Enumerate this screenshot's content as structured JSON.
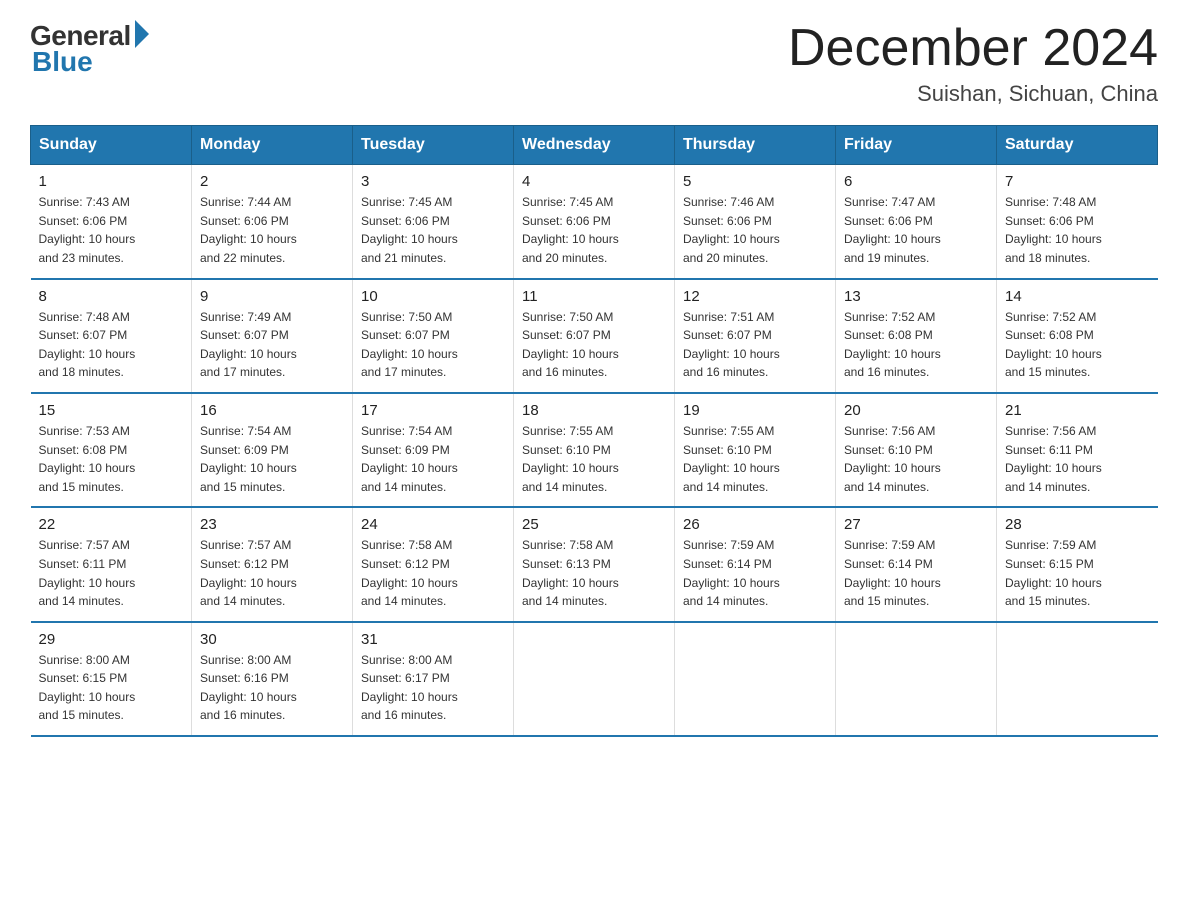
{
  "logo": {
    "general": "General",
    "blue": "Blue"
  },
  "title": "December 2024",
  "location": "Suishan, Sichuan, China",
  "days_of_week": [
    "Sunday",
    "Monday",
    "Tuesday",
    "Wednesday",
    "Thursday",
    "Friday",
    "Saturday"
  ],
  "weeks": [
    [
      {
        "day": "1",
        "sunrise": "7:43 AM",
        "sunset": "6:06 PM",
        "daylight": "10 hours and 23 minutes."
      },
      {
        "day": "2",
        "sunrise": "7:44 AM",
        "sunset": "6:06 PM",
        "daylight": "10 hours and 22 minutes."
      },
      {
        "day": "3",
        "sunrise": "7:45 AM",
        "sunset": "6:06 PM",
        "daylight": "10 hours and 21 minutes."
      },
      {
        "day": "4",
        "sunrise": "7:45 AM",
        "sunset": "6:06 PM",
        "daylight": "10 hours and 20 minutes."
      },
      {
        "day": "5",
        "sunrise": "7:46 AM",
        "sunset": "6:06 PM",
        "daylight": "10 hours and 20 minutes."
      },
      {
        "day": "6",
        "sunrise": "7:47 AM",
        "sunset": "6:06 PM",
        "daylight": "10 hours and 19 minutes."
      },
      {
        "day": "7",
        "sunrise": "7:48 AM",
        "sunset": "6:06 PM",
        "daylight": "10 hours and 18 minutes."
      }
    ],
    [
      {
        "day": "8",
        "sunrise": "7:48 AM",
        "sunset": "6:07 PM",
        "daylight": "10 hours and 18 minutes."
      },
      {
        "day": "9",
        "sunrise": "7:49 AM",
        "sunset": "6:07 PM",
        "daylight": "10 hours and 17 minutes."
      },
      {
        "day": "10",
        "sunrise": "7:50 AM",
        "sunset": "6:07 PM",
        "daylight": "10 hours and 17 minutes."
      },
      {
        "day": "11",
        "sunrise": "7:50 AM",
        "sunset": "6:07 PM",
        "daylight": "10 hours and 16 minutes."
      },
      {
        "day": "12",
        "sunrise": "7:51 AM",
        "sunset": "6:07 PM",
        "daylight": "10 hours and 16 minutes."
      },
      {
        "day": "13",
        "sunrise": "7:52 AM",
        "sunset": "6:08 PM",
        "daylight": "10 hours and 16 minutes."
      },
      {
        "day": "14",
        "sunrise": "7:52 AM",
        "sunset": "6:08 PM",
        "daylight": "10 hours and 15 minutes."
      }
    ],
    [
      {
        "day": "15",
        "sunrise": "7:53 AM",
        "sunset": "6:08 PM",
        "daylight": "10 hours and 15 minutes."
      },
      {
        "day": "16",
        "sunrise": "7:54 AM",
        "sunset": "6:09 PM",
        "daylight": "10 hours and 15 minutes."
      },
      {
        "day": "17",
        "sunrise": "7:54 AM",
        "sunset": "6:09 PM",
        "daylight": "10 hours and 14 minutes."
      },
      {
        "day": "18",
        "sunrise": "7:55 AM",
        "sunset": "6:10 PM",
        "daylight": "10 hours and 14 minutes."
      },
      {
        "day": "19",
        "sunrise": "7:55 AM",
        "sunset": "6:10 PM",
        "daylight": "10 hours and 14 minutes."
      },
      {
        "day": "20",
        "sunrise": "7:56 AM",
        "sunset": "6:10 PM",
        "daylight": "10 hours and 14 minutes."
      },
      {
        "day": "21",
        "sunrise": "7:56 AM",
        "sunset": "6:11 PM",
        "daylight": "10 hours and 14 minutes."
      }
    ],
    [
      {
        "day": "22",
        "sunrise": "7:57 AM",
        "sunset": "6:11 PM",
        "daylight": "10 hours and 14 minutes."
      },
      {
        "day": "23",
        "sunrise": "7:57 AM",
        "sunset": "6:12 PM",
        "daylight": "10 hours and 14 minutes."
      },
      {
        "day": "24",
        "sunrise": "7:58 AM",
        "sunset": "6:12 PM",
        "daylight": "10 hours and 14 minutes."
      },
      {
        "day": "25",
        "sunrise": "7:58 AM",
        "sunset": "6:13 PM",
        "daylight": "10 hours and 14 minutes."
      },
      {
        "day": "26",
        "sunrise": "7:59 AM",
        "sunset": "6:14 PM",
        "daylight": "10 hours and 14 minutes."
      },
      {
        "day": "27",
        "sunrise": "7:59 AM",
        "sunset": "6:14 PM",
        "daylight": "10 hours and 15 minutes."
      },
      {
        "day": "28",
        "sunrise": "7:59 AM",
        "sunset": "6:15 PM",
        "daylight": "10 hours and 15 minutes."
      }
    ],
    [
      {
        "day": "29",
        "sunrise": "8:00 AM",
        "sunset": "6:15 PM",
        "daylight": "10 hours and 15 minutes."
      },
      {
        "day": "30",
        "sunrise": "8:00 AM",
        "sunset": "6:16 PM",
        "daylight": "10 hours and 16 minutes."
      },
      {
        "day": "31",
        "sunrise": "8:00 AM",
        "sunset": "6:17 PM",
        "daylight": "10 hours and 16 minutes."
      },
      null,
      null,
      null,
      null
    ]
  ],
  "labels": {
    "sunrise": "Sunrise:",
    "sunset": "Sunset:",
    "daylight": "Daylight:"
  }
}
